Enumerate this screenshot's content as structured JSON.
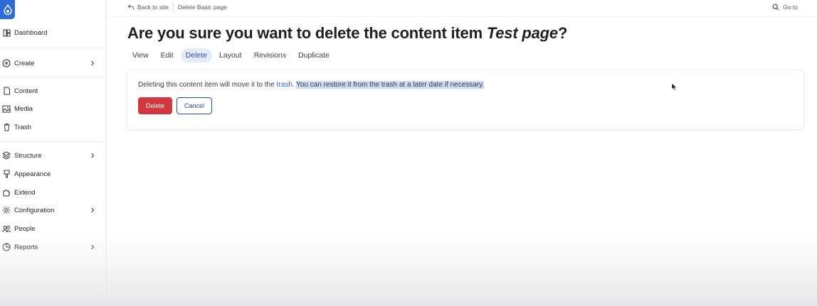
{
  "sidebar": {
    "items": [
      {
        "label": "Dashboard",
        "icon": "dashboard-icon"
      },
      {
        "label": "Create",
        "icon": "plus-circle-icon",
        "has_children": true
      },
      {
        "label": "Content",
        "icon": "document-icon"
      },
      {
        "label": "Media",
        "icon": "image-icon"
      },
      {
        "label": "Trash",
        "icon": "trash-icon"
      },
      {
        "label": "Structure",
        "icon": "layers-icon",
        "has_children": true
      },
      {
        "label": "Appearance",
        "icon": "brush-icon"
      },
      {
        "label": "Extend",
        "icon": "puzzle-icon"
      },
      {
        "label": "Configuration",
        "icon": "gear-icon",
        "has_children": true
      },
      {
        "label": "People",
        "icon": "people-icon"
      },
      {
        "label": "Reports",
        "icon": "chart-icon",
        "has_children": true
      }
    ]
  },
  "topbar": {
    "back_label": "Back to site",
    "page_label": "Delete Basic page",
    "goto_label": "Go to"
  },
  "page": {
    "title_main": "Are you sure you want to delete the content item ",
    "title_item": "Test page",
    "title_end": "?"
  },
  "tabs": [
    {
      "label": "View",
      "active": false
    },
    {
      "label": "Edit",
      "active": false
    },
    {
      "label": "Delete",
      "active": true
    },
    {
      "label": "Layout",
      "active": false
    },
    {
      "label": "Revisions",
      "active": false
    },
    {
      "label": "Duplicate",
      "active": false
    }
  ],
  "confirm": {
    "message_before": "Deleting this content item will move it to the ",
    "link_text": "trash",
    "message_after": ". ",
    "message_highlight": "You can restore it from the trash at a later date if necessary.",
    "delete_label": "Delete",
    "cancel_label": "Cancel"
  },
  "colors": {
    "accent": "#2a4f9e",
    "danger": "#d0373f",
    "logo": "#2f6bd6"
  }
}
